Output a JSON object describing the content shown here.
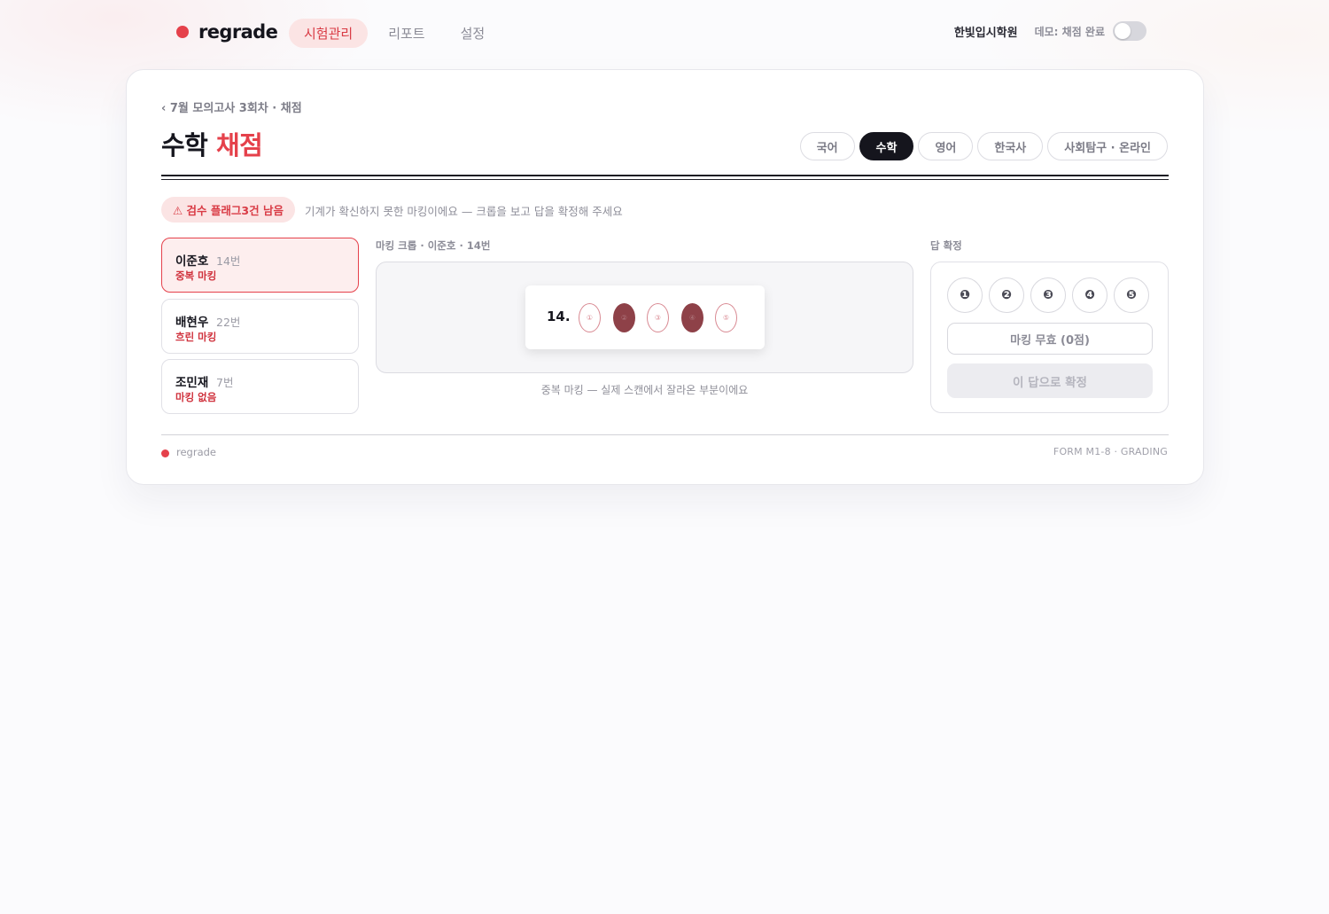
{
  "app": {
    "brand": "regrade"
  },
  "nav": {
    "tabs": [
      {
        "label": "시험관리",
        "active": true
      },
      {
        "label": "리포트",
        "active": false
      },
      {
        "label": "설정",
        "active": false
      }
    ],
    "org_name": "한빛입시학원",
    "demo_label": "데모: 채점 완료",
    "demo_toggle_on": false
  },
  "header": {
    "breadcrumb": "‹ 7월 모의고사 3회차 · 채점",
    "title_main": "수학",
    "title_accent": "채점",
    "subjects": [
      {
        "label": "국어",
        "active": false
      },
      {
        "label": "수학",
        "active": true
      },
      {
        "label": "영어",
        "active": false
      },
      {
        "label": "한국사",
        "active": false
      },
      {
        "label": "사회탐구 · 온라인",
        "active": false
      }
    ]
  },
  "review": {
    "flag_badge": "⚠ 검수 플래그3건 남음",
    "flag_description": "기계가 확신하지 못한 마킹이에요 — 크롭을 보고 답을 확정해 주세요",
    "students": [
      {
        "name": "이준호",
        "number": "14번",
        "issue": "중복 마킹",
        "selected": true
      },
      {
        "name": "배현우",
        "number": "22번",
        "issue": "흐린 마킹",
        "selected": false
      },
      {
        "name": "조민재",
        "number": "7번",
        "issue": "마킹 없음",
        "selected": false
      }
    ]
  },
  "crop": {
    "label": "마킹 크롭 · 이준호 · 14번",
    "question_number": "14.",
    "bubbles": [
      {
        "glyph": "①",
        "filled": false
      },
      {
        "glyph": "②",
        "filled": true
      },
      {
        "glyph": "③",
        "filled": false
      },
      {
        "glyph": "④",
        "filled": true
      },
      {
        "glyph": "⑤",
        "filled": false
      }
    ],
    "caption": "중복 마킹 — 실제 스캔에서 잘라온 부분이에요"
  },
  "answer": {
    "label": "답 확정",
    "options": [
      "❶",
      "❷",
      "❸",
      "❹",
      "❺"
    ],
    "invalid_label": "마킹 무효 (0점)",
    "confirm_label": "이 답으로 확정"
  },
  "footer": {
    "brand": "regrade",
    "form_code": "FORM M1-8 · GRADING"
  },
  "colors": {
    "accent": "#e5414b",
    "accent_soft": "#fbe4e4",
    "dark": "#15151d",
    "filled_bubble": "#8e4148"
  }
}
